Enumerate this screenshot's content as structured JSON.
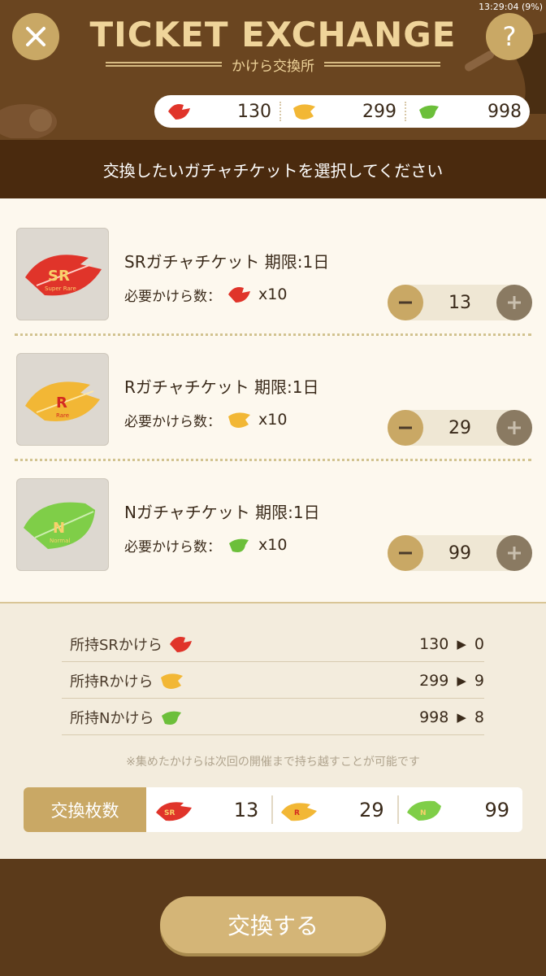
{
  "status": {
    "time": "13:29:04 (9%)"
  },
  "header": {
    "title": "TICKET EXCHANGE",
    "subtitle": "かけら交換所",
    "help_label": "?",
    "counters": [
      {
        "icon": "sr-leaf-fragment-icon",
        "value": "130",
        "color": "#e0342a"
      },
      {
        "icon": "r-leaf-fragment-icon",
        "value": "299",
        "color": "#f2b735"
      },
      {
        "icon": "n-leaf-fragment-icon",
        "value": "998",
        "color": "#6cbf3a"
      }
    ]
  },
  "instruction": "交換したいガチャチケットを選択してください",
  "tickets": [
    {
      "name": "SRガチャチケット 期限:1日",
      "req_label": "必要かけら数：",
      "multiplier": "x10",
      "quantity": "13",
      "leaf_letter": "SR",
      "leaf_sub": "Super Rare",
      "color": "#e0342a"
    },
    {
      "name": "Rガチャチケット 期限:1日",
      "req_label": "必要かけら数：",
      "multiplier": "x10",
      "quantity": "29",
      "leaf_letter": "R",
      "leaf_sub": "Rare",
      "color": "#f2b735"
    },
    {
      "name": "Nガチャチケット 期限:1日",
      "req_label": "必要かけら数：",
      "multiplier": "x10",
      "quantity": "99",
      "leaf_letter": "N",
      "leaf_sub": "Normal",
      "color": "#6cbf3a"
    }
  ],
  "holdings": [
    {
      "label": "所持SRかけら",
      "before": "130",
      "arrow": "▶",
      "after": "0"
    },
    {
      "label": "所持Rかけら",
      "before": "299",
      "arrow": "▶",
      "after": "9"
    },
    {
      "label": "所持Nかけら",
      "before": "998",
      "arrow": "▶",
      "after": "8"
    }
  ],
  "note": "※集めたかけらは次回の開催まで持ち越すことが可能です",
  "exchange": {
    "label": "交換枚数",
    "counts": [
      {
        "letter": "SR",
        "value": "13"
      },
      {
        "letter": "R",
        "value": "29"
      },
      {
        "letter": "N",
        "value": "99"
      }
    ]
  },
  "confirm_label": "交換する"
}
